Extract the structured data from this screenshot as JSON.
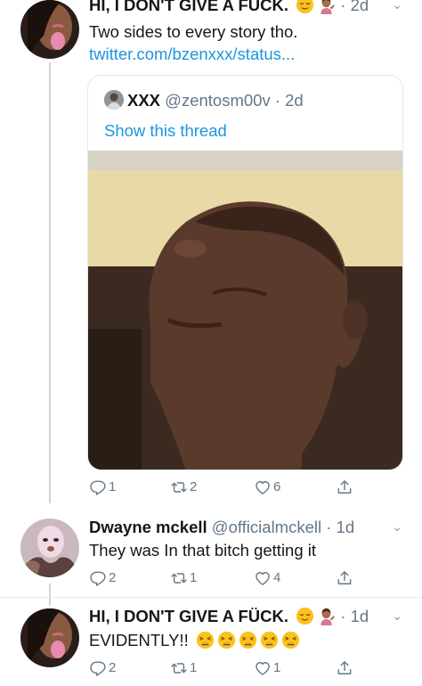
{
  "thread": [
    {
      "name": "HI, I DON'T GIVE A FUCK.",
      "time": "· 2d",
      "text": "Two sides to every story tho.",
      "link": "twitter.com/bzenxxx/status...",
      "quote": {
        "name": "XXX",
        "handle": "@zentosm00v",
        "time": "· 2d",
        "show_thread": "Show this thread"
      },
      "actions": {
        "replies": "1",
        "retweets": "2",
        "likes": "6"
      }
    },
    {
      "name": "Dwayne mckell",
      "handle": "@officialmckell",
      "time": "· 1d",
      "text": "They was In that bitch getting it",
      "actions": {
        "replies": "2",
        "retweets": "1",
        "likes": "4"
      }
    },
    {
      "name": "HI, I DON'T GIVE A FÜCK.",
      "time": "· 1d",
      "text": "EVIDENTLY!!",
      "actions": {
        "replies": "2",
        "retweets": "1",
        "likes": "1"
      }
    }
  ],
  "icons": {
    "reply": "reply-icon",
    "retweet": "retweet-icon",
    "like": "heart-icon",
    "share": "share-icon",
    "more": "chevron-down-icon",
    "relieved": "relieved-face-emoji",
    "tipping": "tipping-hand-woman-emoji",
    "weary": "weary-face-emoji"
  },
  "colors": {
    "link": "#1b95e0",
    "muted": "#657786",
    "thread_line": "#ccd6dd"
  }
}
